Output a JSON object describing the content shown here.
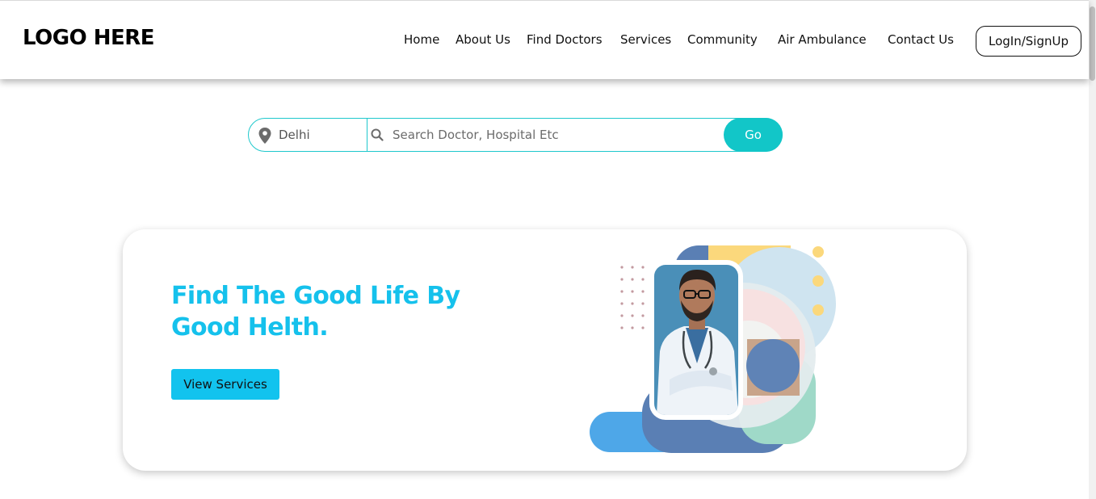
{
  "header": {
    "logo": "LOGO HERE",
    "nav": [
      {
        "label": "Home"
      },
      {
        "label": "About Us"
      },
      {
        "label": "Find Doctors"
      },
      {
        "label": "Services"
      },
      {
        "label": "Community"
      },
      {
        "label": "Air Ambulance"
      },
      {
        "label": "Contact Us"
      }
    ],
    "login_label": "LogIn/SignUp"
  },
  "search": {
    "location": "Delhi",
    "placeholder": "Search Doctor, Hospital Etc",
    "value": "",
    "go_label": "Go"
  },
  "hero": {
    "title_line1": "Find The Good Life By",
    "title_line2": "Good Helth.",
    "button_label": "View Services"
  },
  "colors": {
    "accent_teal": "#12c6c8",
    "accent_cyan": "#15c1ec"
  },
  "icons": [
    "location-pin-icon",
    "search-icon"
  ]
}
